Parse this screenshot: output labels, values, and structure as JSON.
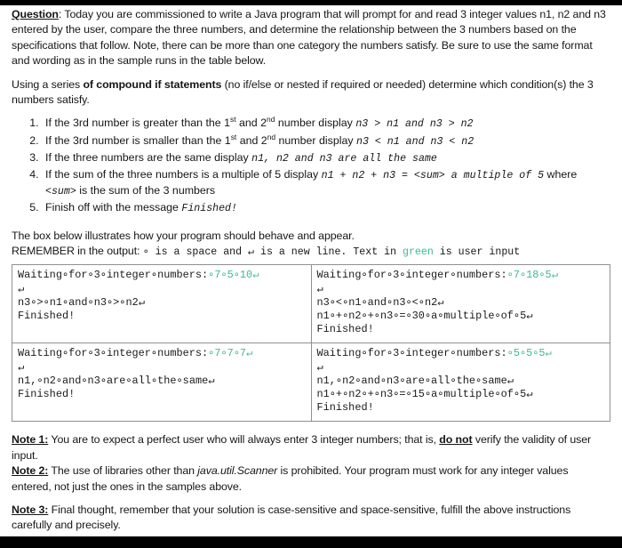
{
  "document": {
    "question_label": "Question",
    "question_body": ": Today you are commissioned to write a Java program that will prompt for and read 3 integer values n1, n2 and n3 entered by the user, compare the three numbers, and determine the relationship between the 3 numbers based on the specifications that follow. Note, there can be more than one category the numbers satisfy. Be sure to use the same format and wording as in the sample runs in the table below.",
    "approach_prefix": "Using a series ",
    "approach_bold": "of compound if statements",
    "approach_suffix": " (no if/else or nested if required or needed) determine which condition(s) the 3 numbers satisfy.",
    "rules": [
      {
        "text_before": "If the 3rd number is greater than the 1",
        "sup1": "st",
        "text_mid": " and 2",
        "sup2": "nd",
        "text_after": " number display ",
        "code": "n3 > n1 and n3 > n2"
      },
      {
        "text_before": "If the 3rd number is smaller than the 1",
        "sup1": "st",
        "text_mid": " and 2",
        "sup2": "nd",
        "text_after": " number display ",
        "code": "n3 < n1 and n3 < n2"
      },
      {
        "text_before": "If the three numbers are the same display ",
        "code": "n1, n2 and n3 are all the same"
      },
      {
        "text_before": " If the sum of the three numbers is a multiple of 5 display ",
        "code": "n1 + n2 + n3 = <sum> a multiple of 5",
        "text_tail_a": " where  ",
        "code_tail": "<sum>",
        "text_tail_b": " is the sum of the 3 numbers"
      },
      {
        "text_before": "Finish off with the message ",
        "code": "Finished!"
      }
    ],
    "box_intro": "The box below illustrates how your program should behave and appear.",
    "remember": {
      "prefix": "REMEMBER in the output: ",
      "dot": "∘",
      "mid1": " is a space and ",
      "newline_glyph": "↵",
      "mid2": " is a new line. Text in ",
      "green_word": "green",
      "suffix": " is user input"
    },
    "green_color": "#3bbd8c",
    "samples": [
      {
        "lines": [
          {
            "black": "Waiting∘for∘3∘integer∘numbers:",
            "green": "∘7∘5∘10↵"
          },
          {
            "black": "↵"
          },
          {
            "black": "n3∘>∘n1∘and∘n3∘>∘n2↵"
          },
          {
            "black": "Finished!"
          }
        ]
      },
      {
        "lines": [
          {
            "black": "Waiting∘for∘3∘integer∘numbers:",
            "green": "∘7∘18∘5↵"
          },
          {
            "black": "↵"
          },
          {
            "black": "n3∘<∘n1∘and∘n3∘<∘n2↵"
          },
          {
            "black": "n1∘+∘n2∘+∘n3∘=∘30∘a∘multiple∘of∘5↵"
          },
          {
            "black": "Finished!"
          }
        ]
      },
      {
        "lines": [
          {
            "black": "Waiting∘for∘3∘integer∘numbers:",
            "green": "∘7∘7∘7↵"
          },
          {
            "black": "↵"
          },
          {
            "black": "n1,∘n2∘and∘n3∘are∘all∘the∘same↵"
          },
          {
            "black": "Finished!"
          }
        ]
      },
      {
        "lines": [
          {
            "black": "Waiting∘for∘3∘integer∘numbers:",
            "green": "∘5∘5∘5↵"
          },
          {
            "black": "↵"
          },
          {
            "black": "n1,∘n2∘and∘n3∘are∘all∘the∘same↵"
          },
          {
            "black": "n1∘+∘n2∘+∘n3∘=∘15∘a∘multiple∘of∘5↵"
          },
          {
            "black": "Finished!"
          }
        ]
      }
    ],
    "notes": [
      {
        "label": "Note 1:",
        "part_a": " You are to expect a perfect user who will always enter 3 integer numbers; that is, ",
        "emph": "do not",
        "part_b": " verify the validity of user input."
      },
      {
        "label": "Note 2:",
        "part_a": " The use of libraries other than ",
        "emph": "java.util.Scanner",
        "part_b": " is prohibited. Your program must work for any integer values entered, not just the ones in the samples above."
      },
      {
        "label": "Note 3:",
        "part_a": " Final thought, remember that your solution is case-sensitive and space-sensitive, fulfill the above instructions carefully and precisely."
      }
    ]
  }
}
